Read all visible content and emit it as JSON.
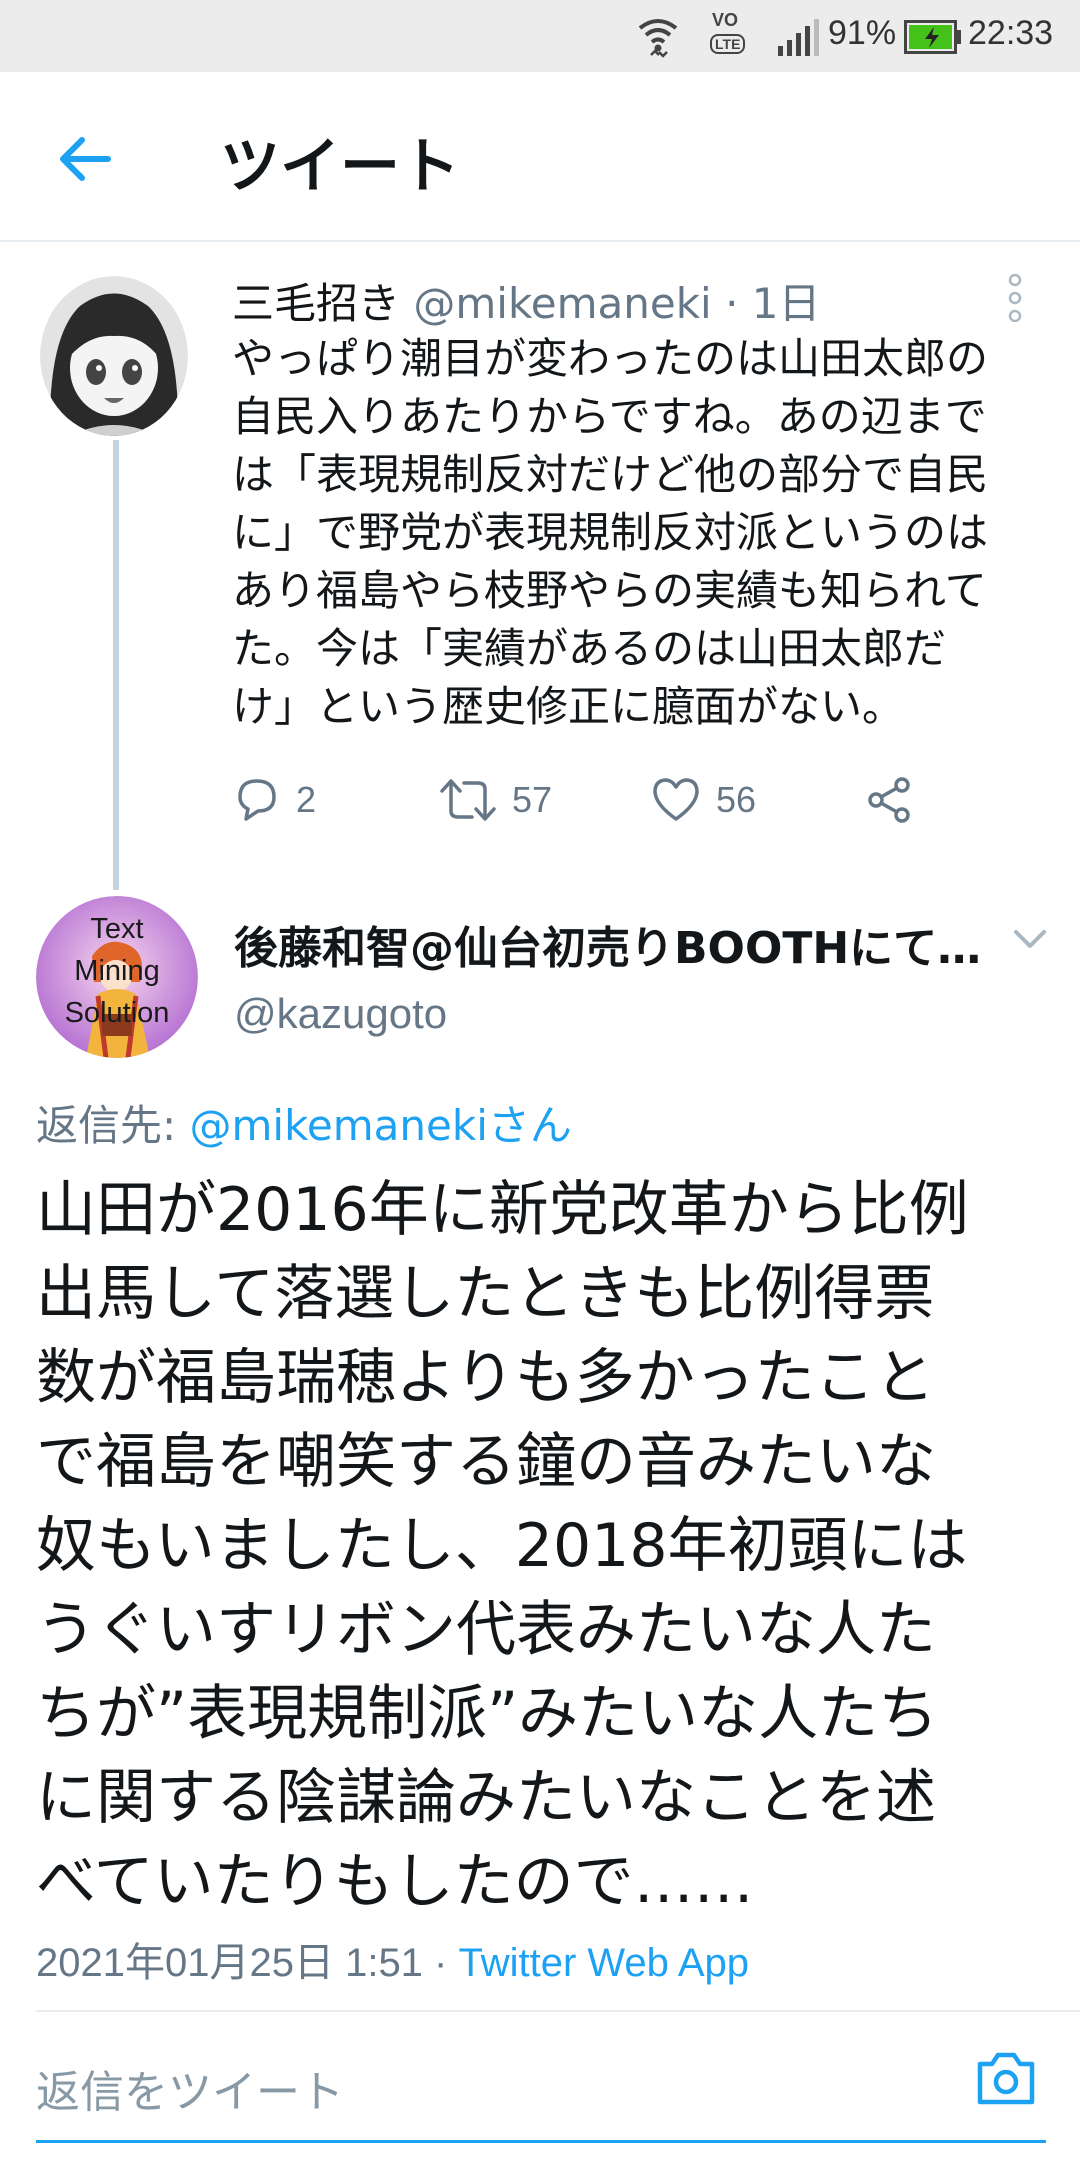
{
  "status_bar": {
    "battery": "91%",
    "time": "22:33",
    "volte_label": "VO",
    "lte_label": "LTE"
  },
  "header": {
    "back_icon": "arrow-left-icon",
    "title": "ツイート"
  },
  "tweet_parent": {
    "display_name": "三毛招き",
    "handle": "@mikemaneki",
    "time": "· 1日",
    "text_lines": [
      "やっぱり潮目が変わったのは山田太郎の",
      "自民入りあたりからですね。あの辺まで",
      "は「表現規制反対だけど他の部分で自民",
      "に」で野党が表現規制反対派というのは",
      "あり福島やら枝野やらの実績も知られて",
      "た。今は「実績があるのは山田太郎だ",
      "け」という歴史修正に臆面がない。"
    ],
    "replies": "2",
    "retweets": "57",
    "likes": "56"
  },
  "tweet_main": {
    "display_name": "後藤和智@仙台初売りBOOTHにて…",
    "handle": "@kazugoto",
    "avatar_text": [
      "Text",
      "Mining",
      "Solution"
    ],
    "reply_to_label": "返信先: ",
    "reply_to_mention": "@mikemanekiさん",
    "text_lines": [
      "山田が2016年に新党改革から比例",
      "出馬して落選したときも比例得票",
      "数が福島瑞穂よりも多かったこと",
      "で福島を嘲笑する鐘の音みたいな",
      "奴もいましたし、2018年初頭には",
      "うぐいすリボン代表みたいな人た",
      "ちが”表現規制派”みたいな人たち",
      "に関する陰謀論みたいなことを述",
      "べていたりもしたので……"
    ],
    "datetime": "2021年01月25日 1:51 · ",
    "source": "Twitter Web App"
  },
  "reply_box": {
    "placeholder": "返信をツイート",
    "camera_icon": "camera-icon"
  },
  "colors": {
    "accent": "#1da1f2",
    "secondary_text": "#657786",
    "thread_line": "#c4d3dd"
  }
}
